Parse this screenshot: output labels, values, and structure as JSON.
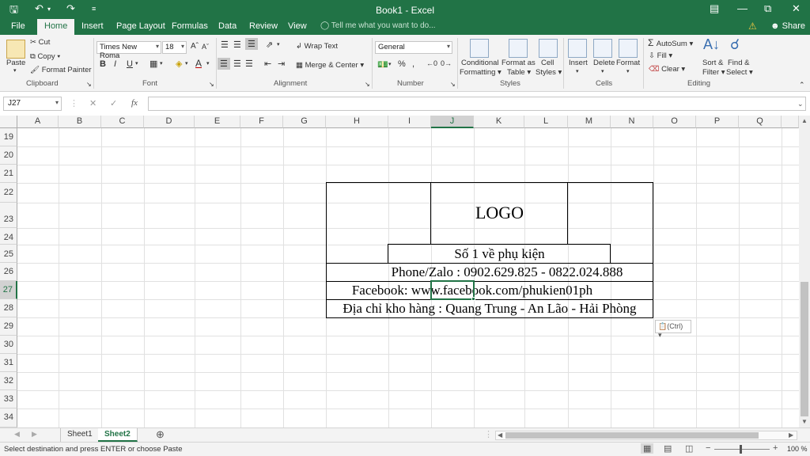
{
  "titlebar": {
    "title": "Book1 - Excel",
    "save_icon": "save-icon",
    "undo_icon": "undo-icon",
    "redo_icon": "redo-icon"
  },
  "tabs": [
    "File",
    "Home",
    "Insert",
    "Page Layout",
    "Formulas",
    "Data",
    "Review",
    "View"
  ],
  "active_tab": "Home",
  "tell_me": "Tell me what you want to do...",
  "share": "Share",
  "clipboard": {
    "paste": "Paste",
    "cut": "Cut",
    "copy": "Copy",
    "format_painter": "Format Painter",
    "label": "Clipboard"
  },
  "font": {
    "name": "Times New Roma",
    "size": "18",
    "bold": "B",
    "italic": "I",
    "underline": "U",
    "label": "Font"
  },
  "alignment": {
    "wrap": "Wrap Text",
    "merge": "Merge & Center",
    "label": "Alignment"
  },
  "number": {
    "format": "General",
    "label": "Number"
  },
  "styles": {
    "conditional": "Conditional",
    "conditional2": "Formatting",
    "format_as": "Format as",
    "table": "Table",
    "cell": "Cell",
    "cell_styles": "Styles",
    "label": "Styles"
  },
  "cells": {
    "insert": "Insert",
    "delete": "Delete",
    "format": "Format",
    "label": "Cells"
  },
  "editing": {
    "autosum": "AutoSum",
    "fill": "Fill",
    "clear": "Clear",
    "sort": "Sort &",
    "filter": "Filter",
    "find": "Find &",
    "select": "Select",
    "label": "Editing"
  },
  "formula_bar": {
    "name_box": "J27",
    "fx": "fx",
    "value": ""
  },
  "columns": [
    "A",
    "B",
    "C",
    "D",
    "E",
    "F",
    "G",
    "H",
    "I",
    "J",
    "K",
    "L",
    "M",
    "N",
    "O",
    "P",
    "Q"
  ],
  "rows": [
    "19",
    "20",
    "21",
    "22",
    "23",
    "24",
    "25",
    "26",
    "27",
    "28",
    "29",
    "30",
    "31",
    "32",
    "33",
    "34"
  ],
  "selected_cell": "J27",
  "cells_content": {
    "logo": "LOGO",
    "slogan": "Số 1 về phụ kiện",
    "phone": "Phone/Zalo : 0902.629.825 - 0822.024.888",
    "facebook": "Facebook: www.facebook.com/phukien01ph",
    "address": "Địa chỉ kho hàng : Quang Trung - An Lão - Hải Phòng"
  },
  "paste_options": "(Ctrl)",
  "sheets": [
    "Sheet1",
    "Sheet2"
  ],
  "active_sheet": "Sheet2",
  "status": "Select destination and press ENTER or choose Paste",
  "zoom": "100 %",
  "colors": {
    "accent": "#217346"
  }
}
